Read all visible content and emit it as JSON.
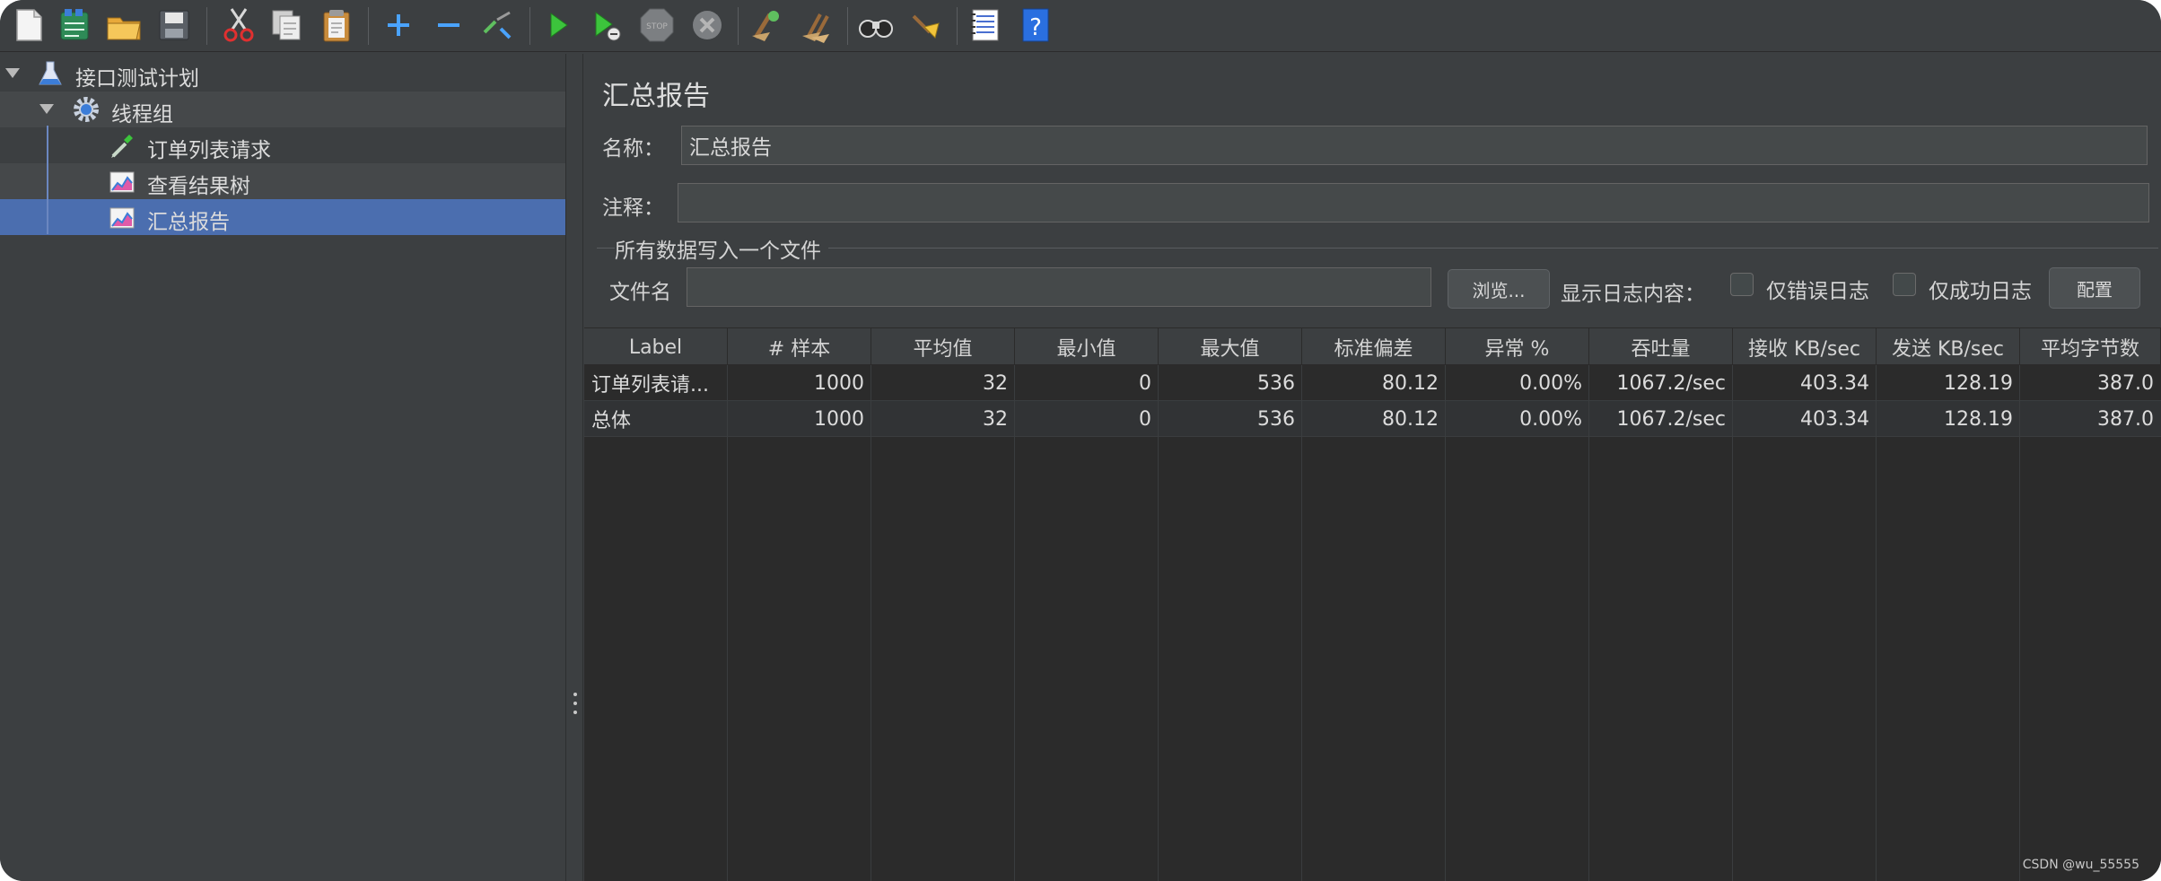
{
  "toolbar": {
    "icons": [
      "new-icon",
      "templates-icon",
      "open-icon",
      "save-icon",
      "cut-icon",
      "copy-icon",
      "paste-icon",
      "expand-icon",
      "collapse-icon",
      "toggle-icon",
      "start-icon",
      "start-no-pause-icon",
      "stop-icon",
      "shutdown-icon",
      "clear-icon",
      "clear-all-icon",
      "search-icon",
      "reset-search-icon",
      "function-helper-icon",
      "help-icon"
    ]
  },
  "tree": {
    "items": [
      {
        "label": "接口测试计划",
        "icon": "test-plan-flask-icon"
      },
      {
        "label": "线程组",
        "icon": "thread-group-gear-icon"
      },
      {
        "label": "订单列表请求",
        "icon": "sampler-pipette-icon"
      },
      {
        "label": "查看结果树",
        "icon": "listener-graph-icon"
      },
      {
        "label": "汇总报告",
        "icon": "listener-graph-icon"
      }
    ]
  },
  "panel": {
    "title": "汇总报告",
    "name_label": "名称：",
    "name_value": "汇总报告",
    "comment_label": "注释：",
    "comment_value": "",
    "group_title": "所有数据写入一个文件",
    "filename_label": "文件名",
    "filename_value": "",
    "browse_button": "浏览...",
    "log_label": "显示日志内容：",
    "errors_only_label": "仅错误日志",
    "success_only_label": "仅成功日志",
    "configure_button": "配置"
  },
  "table": {
    "columns": [
      "Label",
      "# 样本",
      "平均值",
      "最小值",
      "最大值",
      "标准偏差",
      "异常 %",
      "吞吐量",
      "接收 KB/sec",
      "发送 KB/sec",
      "平均字节数"
    ],
    "rows": [
      [
        "订单列表请...",
        "1000",
        "32",
        "0",
        "536",
        "80.12",
        "0.00%",
        "1067.2/sec",
        "403.34",
        "128.19",
        "387.0"
      ],
      [
        "总体",
        "1000",
        "32",
        "0",
        "536",
        "80.12",
        "0.00%",
        "1067.2/sec",
        "403.34",
        "128.19",
        "387.0"
      ]
    ]
  },
  "watermark": "CSDN @wu_55555",
  "colors": {
    "background": "#3c3f41",
    "table_background": "#2b2b2b",
    "selection": "#4b6eaf"
  }
}
